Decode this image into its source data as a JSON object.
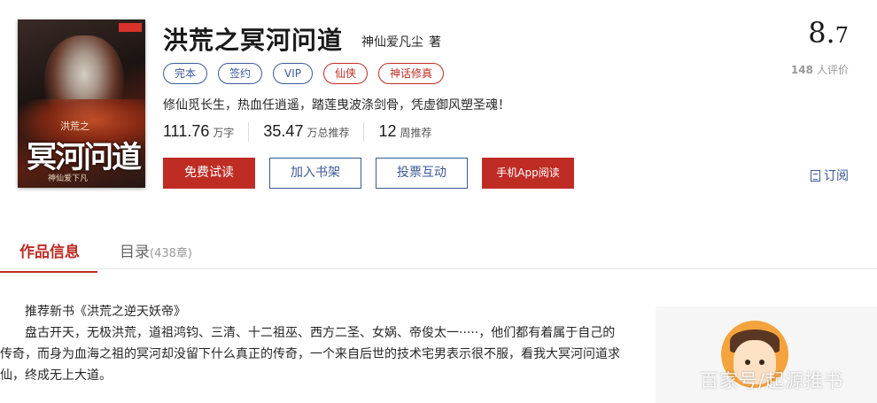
{
  "book": {
    "title": "洪荒之冥河问道",
    "author": "神仙爱凡尘",
    "author_suffix": "著",
    "cover": {
      "subtitle": "洪荒之",
      "title": "冥河问道",
      "author": "神仙爱下凡"
    },
    "tags": [
      {
        "label": "完本",
        "color": "#3b5998"
      },
      {
        "label": "签约",
        "color": "#3b5998"
      },
      {
        "label": "VIP",
        "color": "#3b5998"
      },
      {
        "label": "仙侠",
        "color": "#bf2c24"
      },
      {
        "label": "神话修真",
        "color": "#bf2c24"
      }
    ],
    "intro": "修仙觅长生，热血任逍遥，踏莲曳波涤剑骨，凭虚御风塑圣魂！",
    "stats": [
      {
        "num": "111.76",
        "unit": "万字"
      },
      {
        "num": "35.47",
        "unit": "万总推荐"
      },
      {
        "num": "12",
        "unit": "周推荐"
      }
    ]
  },
  "buttons": {
    "free_read": "免费试读",
    "add_shelf": "加入书架",
    "vote": "投票互动",
    "app_read": "手机App阅读"
  },
  "rating": {
    "score_int": "8.",
    "score_dec": "7",
    "count": "148",
    "count_label": "人评价"
  },
  "catalog_link": "订阅",
  "tabs": {
    "info": "作品信息",
    "catalog": "目录",
    "catalog_count": "(438章)"
  },
  "description": {
    "recommend": "推荐新书《洪荒之逆天妖帝》",
    "body": "盘古开天，无极洪荒，道祖鸿钧、三清、十二祖巫、西方二圣、女娲、帝俊太一·····，他们都有着属于自己的传奇，而身为血海之祖的冥河却没留下什么真正的传奇，一个来自后世的技术宅男表示很不服，看我大冥河问道求仙，终成无上大道。"
  },
  "watermark": "百家号/起源推书",
  "colors": {
    "accent_red": "#bf2c24",
    "link_blue": "#3b5998"
  }
}
